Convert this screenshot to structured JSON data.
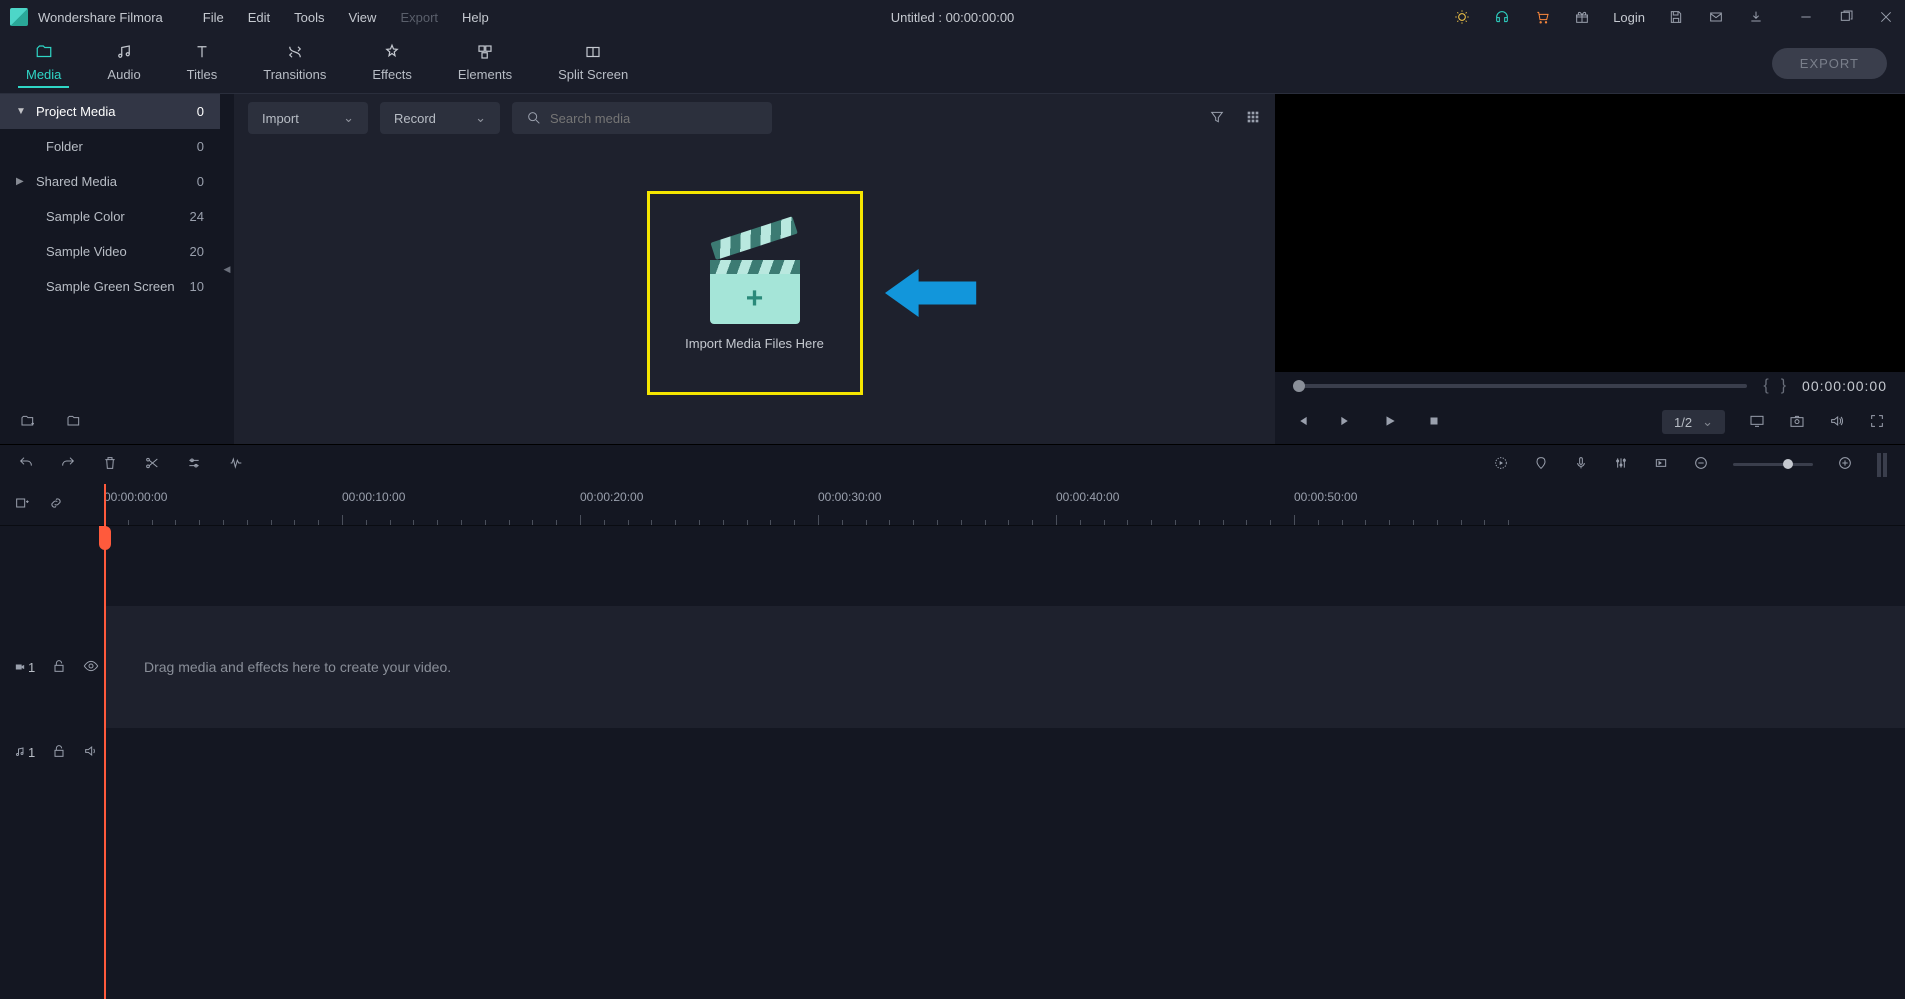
{
  "app_name": "Wondershare Filmora",
  "menubar": [
    "File",
    "Edit",
    "Tools",
    "View",
    "Export",
    "Help"
  ],
  "menubar_disabled_index": 4,
  "title": "Untitled : 00:00:00:00",
  "login_label": "Login",
  "tabs": [
    {
      "label": "Media",
      "active": true
    },
    {
      "label": "Audio"
    },
    {
      "label": "Titles"
    },
    {
      "label": "Transitions"
    },
    {
      "label": "Effects"
    },
    {
      "label": "Elements"
    },
    {
      "label": "Split Screen"
    }
  ],
  "export_btn": "EXPORT",
  "sidebar": [
    {
      "label": "Project Media",
      "count": "0",
      "arrow": "▼",
      "active": true
    },
    {
      "label": "Folder",
      "count": "0",
      "indent": true
    },
    {
      "label": "Shared Media",
      "count": "0",
      "arrow": "▶"
    },
    {
      "label": "Sample Color",
      "count": "24"
    },
    {
      "label": "Sample Video",
      "count": "20"
    },
    {
      "label": "Sample Green Screen",
      "count": "10"
    }
  ],
  "dropdowns": {
    "import": "Import",
    "record": "Record"
  },
  "search_placeholder": "Search media",
  "import_text": "Import Media Files Here",
  "preview": {
    "timecode": "00:00:00:00",
    "speed": "1/2"
  },
  "ruler_labels": [
    "00:00:00:00",
    "00:00:10:00",
    "00:00:20:00",
    "00:00:30:00",
    "00:00:40:00",
    "00:00:50:00"
  ],
  "track_hint": "Drag media and effects here to create your video.",
  "tracks": {
    "video": "1",
    "audio": "1"
  }
}
